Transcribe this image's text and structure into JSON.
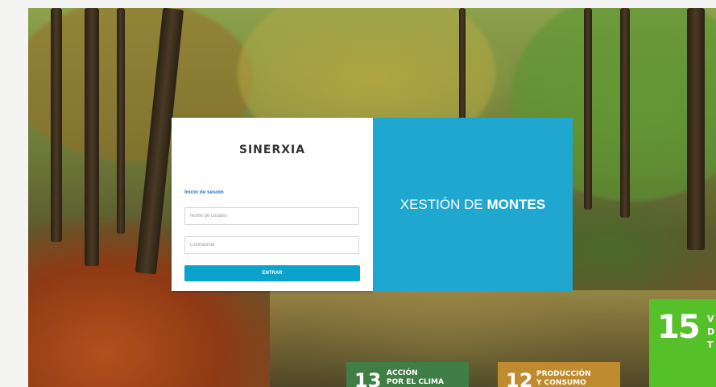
{
  "login": {
    "brand": "SINERXIA",
    "section_label": "Inicio de sesión",
    "username_placeholder": "Nome de usuario",
    "password_placeholder": "Contrasinal",
    "submit_label": "ENTRAR"
  },
  "hero": {
    "title_light": "XESTIÓN DE ",
    "title_bold": "MONTES"
  },
  "sdg_badges": [
    {
      "number": "13",
      "text_line1": "ACCIÓN",
      "text_line2": "POR EL CLIMA",
      "color": "#3f7e44"
    },
    {
      "number": "12",
      "text_line1": "PRODUCCIÓN",
      "text_line2": "Y CONSUMO",
      "color": "#bf8b2e"
    },
    {
      "number": "15",
      "text_line1": "V",
      "text_line2": "D",
      "text_line3": "T",
      "color": "#56c02b"
    }
  ],
  "colors": {
    "accent": "#1fa7cf",
    "button": "#0aa3cc",
    "link": "#2a6fd6"
  }
}
